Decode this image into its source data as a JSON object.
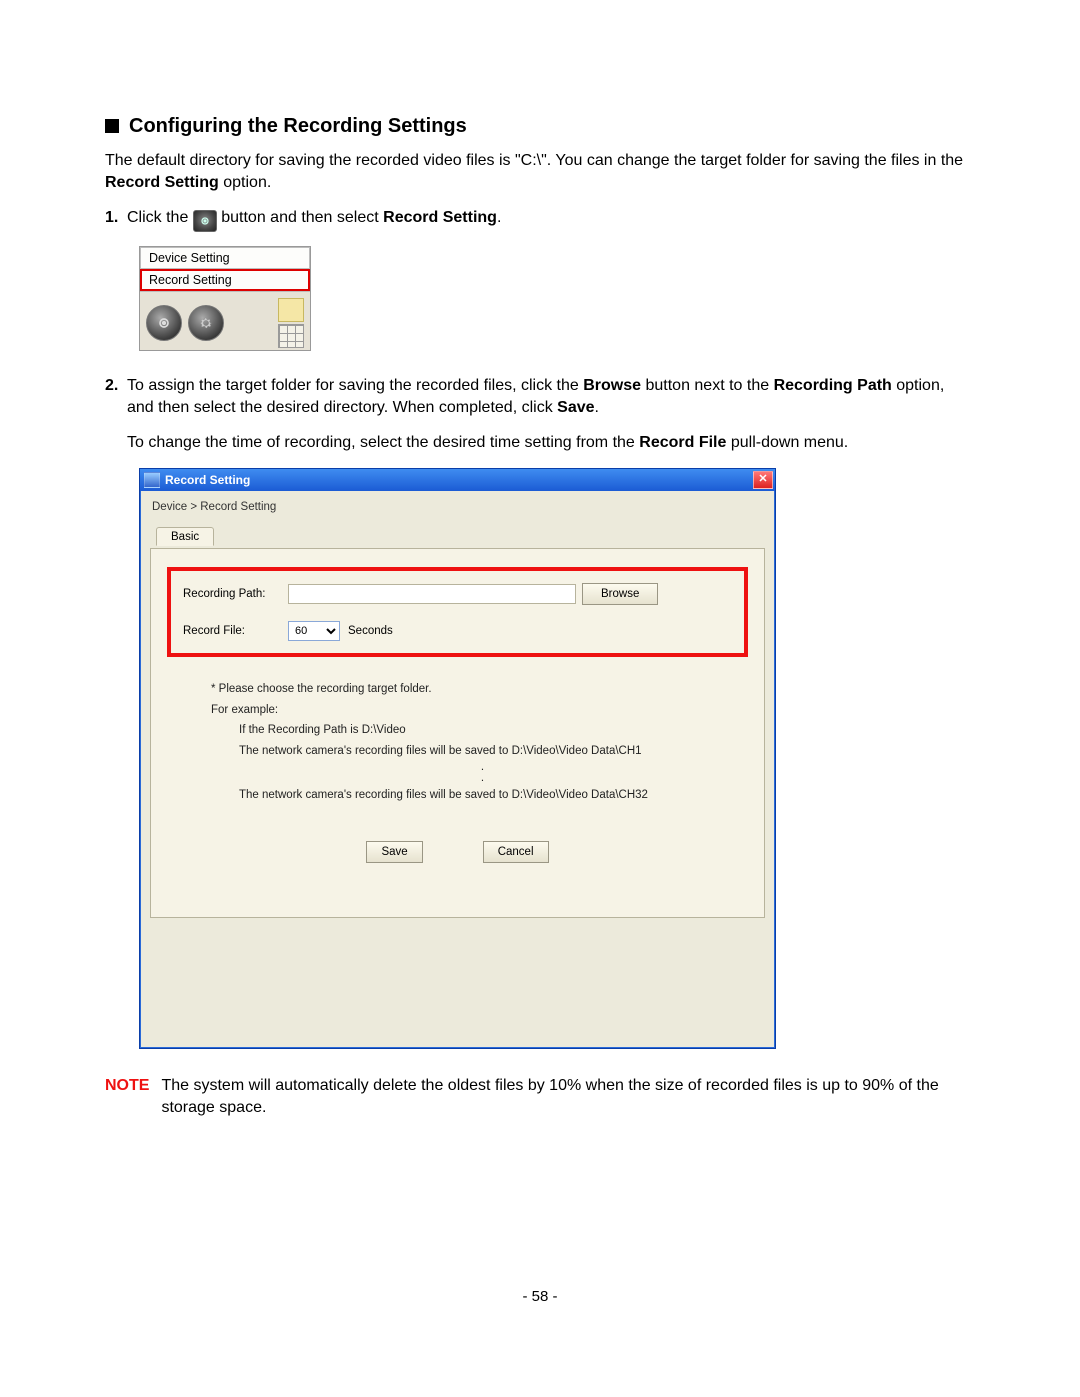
{
  "heading": "Configuring the Recording Settings",
  "intro_a": "The default directory for saving the recorded video files is \"C:\\\". You can change the target folder for saving the files in the ",
  "intro_bold": "Record Setting",
  "intro_b": " option.",
  "step1": {
    "num": "1.",
    "a": "Click the ",
    "b": " button and then select ",
    "c": "Record Setting",
    "d": "."
  },
  "menu": {
    "item1": "Device Setting",
    "item2": "Record Setting"
  },
  "step2": {
    "num": "2.",
    "a": "To assign the target folder for saving the recorded files, click the ",
    "browse": "Browse",
    "b": " button next to the ",
    "rp": "Recording Path",
    "c": " option, and then select the desired directory. When completed, click ",
    "save": "Save",
    "d": ".",
    "line2a": "To change the time of recording, select the desired time setting from the ",
    "rf": "Record File",
    "line2b": " pull-down menu."
  },
  "win": {
    "title": "Record Setting",
    "breadcrumb": "Device > Record Setting",
    "tab": "Basic",
    "labels": {
      "path": "Recording Path:",
      "file": "Record File:"
    },
    "path_value": "",
    "browse": "Browse",
    "file_value": "60",
    "unit": "Seconds",
    "help": {
      "l1": "* Please choose the recording target folder.",
      "l2": "For example:",
      "l3": "If the Recording Path is D:\\Video",
      "l4": "The network camera's recording files will be saved to D:\\Video\\Video Data\\CH1",
      "dots": ".",
      "l5": "The network camera's recording files will be saved to D:\\Video\\Video Data\\CH32"
    },
    "buttons": {
      "save": "Save",
      "cancel": "Cancel"
    }
  },
  "note": {
    "label": "NOTE",
    "text": "The system will automatically delete the oldest files by 10% when the size of recorded files is up to 90% of the storage space."
  },
  "page_number": "- 58 -"
}
